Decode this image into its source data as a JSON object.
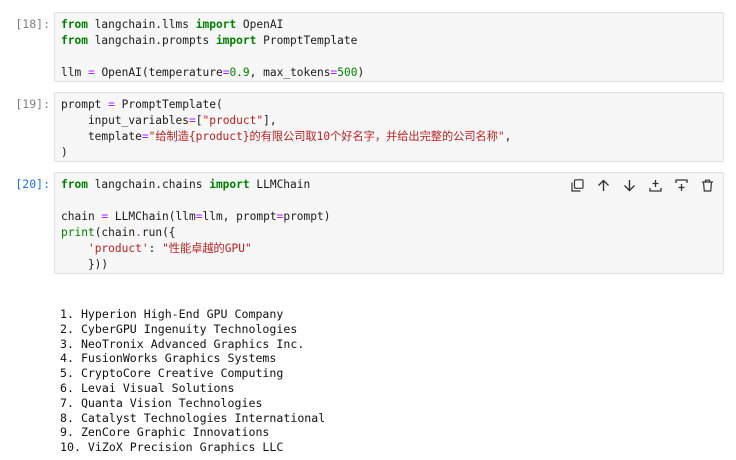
{
  "cells": [
    {
      "prompt": "[18]:",
      "lines": [
        [
          {
            "t": "from",
            "c": "kw"
          },
          {
            "t": " langchain.llms "
          },
          {
            "t": "import",
            "c": "kw"
          },
          {
            "t": " OpenAI"
          }
        ],
        [
          {
            "t": "from",
            "c": "kw"
          },
          {
            "t": " langchain.prompts "
          },
          {
            "t": "import",
            "c": "kw"
          },
          {
            "t": " PromptTemplate"
          }
        ],
        [],
        [
          {
            "t": "llm "
          },
          {
            "t": "=",
            "c": "op"
          },
          {
            "t": " OpenAI(temperature"
          },
          {
            "t": "=",
            "c": "op"
          },
          {
            "t": "0.9",
            "c": "num"
          },
          {
            "t": ", max_tokens"
          },
          {
            "t": "=",
            "c": "op"
          },
          {
            "t": "500",
            "c": "num"
          },
          {
            "t": ")"
          }
        ]
      ]
    },
    {
      "prompt": "[19]:",
      "lines": [
        [
          {
            "t": "prompt "
          },
          {
            "t": "=",
            "c": "op"
          },
          {
            "t": " PromptTemplate("
          }
        ],
        [
          {
            "t": "    input_variables"
          },
          {
            "t": "=",
            "c": "op"
          },
          {
            "t": "["
          },
          {
            "t": "\"product\"",
            "c": "str"
          },
          {
            "t": "],"
          }
        ],
        [
          {
            "t": "    template"
          },
          {
            "t": "=",
            "c": "op"
          },
          {
            "t": "\"给制造{product}的有限公司取10个好名字，并给出完整的公司名称\"",
            "c": "str"
          },
          {
            "t": ","
          }
        ],
        [
          {
            "t": ")"
          }
        ]
      ]
    },
    {
      "prompt": "[20]:",
      "lines": [
        [
          {
            "t": "from",
            "c": "kw"
          },
          {
            "t": " langchain.chains "
          },
          {
            "t": "import",
            "c": "kw"
          },
          {
            "t": " LLMChain"
          }
        ],
        [],
        [
          {
            "t": "chain "
          },
          {
            "t": "=",
            "c": "op"
          },
          {
            "t": " LLMChain(llm"
          },
          {
            "t": "=",
            "c": "op"
          },
          {
            "t": "llm, prompt"
          },
          {
            "t": "=",
            "c": "op"
          },
          {
            "t": "prompt)"
          }
        ],
        [
          {
            "t": "print",
            "c": "num"
          },
          {
            "t": "(chain"
          },
          {
            "t": ".",
            "c": "op"
          },
          {
            "t": "run({"
          }
        ],
        [
          {
            "t": "    "
          },
          {
            "t": "'product'",
            "c": "str"
          },
          {
            "t": ": "
          },
          {
            "t": "\"性能卓越的GPU\"",
            "c": "str"
          }
        ],
        [
          {
            "t": "    }))"
          }
        ]
      ]
    }
  ],
  "toolbar": {
    "icons": [
      "copy-icon",
      "move-up-icon",
      "move-down-icon",
      "insert-above-icon",
      "insert-below-icon",
      "delete-icon"
    ]
  },
  "output": {
    "lines": [
      "1. Hyperion High-End GPU Company",
      "2. CyberGPU Ingenuity Technologies",
      "3. NeoTronix Advanced Graphics Inc.",
      "4. FusionWorks Graphics Systems",
      "5. CryptoCore Creative Computing",
      "6. Levai Visual Solutions",
      "7. Quanta Vision Technologies",
      "8. Catalyst Technologies International",
      "9. ZenCore Graphic Innovations",
      "10. ViZoX Precision Graphics LLC"
    ]
  }
}
